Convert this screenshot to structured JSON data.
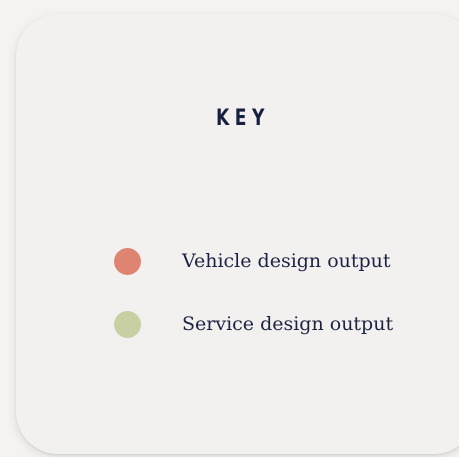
{
  "legend": {
    "title": "KEY",
    "items": [
      {
        "label": "Vehicle design output",
        "color": "#e08472"
      },
      {
        "label": "Service design output",
        "color": "#c8cfa3"
      }
    ]
  },
  "colors": {
    "page_background": "#f4f3f2",
    "card_background": "#f3f1f0",
    "text": "#1c2342"
  }
}
